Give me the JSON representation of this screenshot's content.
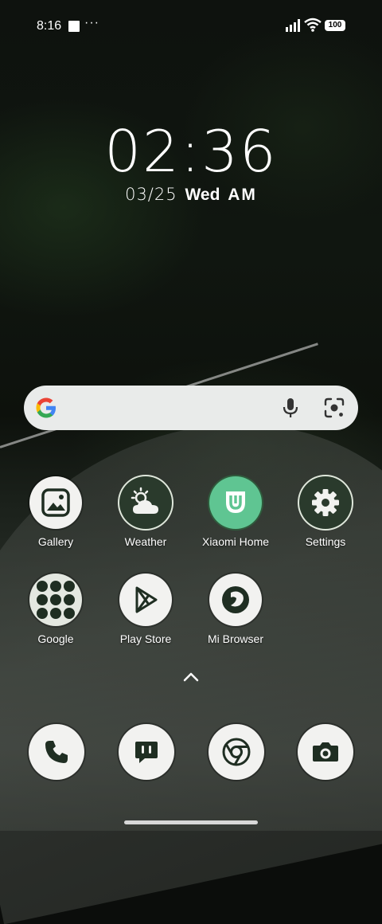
{
  "status_bar": {
    "time": "8:16",
    "overflow": "···",
    "battery": "100"
  },
  "clock": {
    "time": "02:36",
    "date": "03/25",
    "day": "Wed",
    "ampm": "AM"
  },
  "search": {
    "left_icon": "google-g-icon",
    "mic_icon": "mic-icon",
    "lens_icon": "lens-icon"
  },
  "apps": [
    {
      "label": "Gallery",
      "icon": "gallery-icon"
    },
    {
      "label": "Weather",
      "icon": "weather-icon"
    },
    {
      "label": "Xiaomi Home",
      "icon": "xiaomi-home-icon"
    },
    {
      "label": "Settings",
      "icon": "gear-icon"
    },
    {
      "label": "Google",
      "icon": "google-folder-icon"
    },
    {
      "label": "Play Store",
      "icon": "play-store-icon"
    },
    {
      "label": "Mi Browser",
      "icon": "mi-browser-icon"
    }
  ],
  "dock": [
    {
      "icon": "phone-icon"
    },
    {
      "icon": "messages-icon"
    },
    {
      "icon": "chrome-icon"
    },
    {
      "icon": "camera-icon"
    }
  ],
  "colors": {
    "icon_dark": "#2a3a2c",
    "icon_light": "#f2f2f0",
    "xiaomi_mint": "#5fc592"
  }
}
